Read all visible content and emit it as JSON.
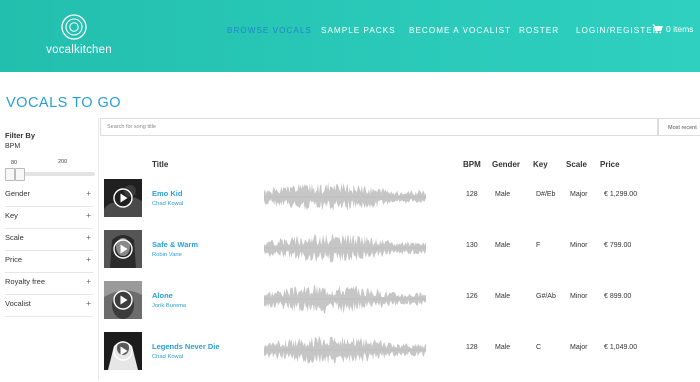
{
  "header": {
    "brand": "vocalkitchen",
    "nav": [
      {
        "label": "BROWSE VOCALS",
        "active": true
      },
      {
        "label": "SAMPLE PACKS",
        "active": false
      },
      {
        "label": "BECOME A VOCALIST",
        "active": false
      },
      {
        "label": "ROSTER",
        "active": false
      },
      {
        "label": "LOGIN/REGISTER",
        "active": false
      }
    ],
    "cart_label": "0 items",
    "cart_icon": "cart-icon"
  },
  "page_title": "VOCALS TO GO",
  "filters": {
    "title": "Filter By",
    "bpm_label": "BPM",
    "bpm_min": "80",
    "bpm_max": "200",
    "facets": [
      {
        "label": "Gender",
        "icon": "plus"
      },
      {
        "label": "Key",
        "icon": "plus"
      },
      {
        "label": "Scale",
        "icon": "plus"
      },
      {
        "label": "Price",
        "icon": "plus"
      },
      {
        "label": "Royalty free",
        "icon": "plus"
      },
      {
        "label": "Vocalist",
        "icon": "plus"
      }
    ]
  },
  "search": {
    "placeholder": "Search for song title",
    "value": "",
    "sort_label": "Most recent"
  },
  "table": {
    "columns": {
      "title": "Title",
      "bpm": "BPM",
      "gender": "Gender",
      "key": "Key",
      "scale": "Scale",
      "price": "Price"
    },
    "rows": [
      {
        "title": "Emo Kid",
        "artist": "Chad Kowal",
        "bpm": "128",
        "gender": "Male",
        "key": "D#/Eb",
        "scale": "Major",
        "price": "€ 1,299.00",
        "play_icon": "play-icon"
      },
      {
        "title": "Safe & Warm",
        "artist": "Robin Vane",
        "bpm": "130",
        "gender": "Male",
        "key": "F",
        "scale": "Minor",
        "price": "€ 799.00",
        "play_icon": "play-icon"
      },
      {
        "title": "Alone",
        "artist": "Jorik Burema",
        "bpm": "126",
        "gender": "Male",
        "key": "G#/Ab",
        "scale": "Minor",
        "price": "€ 899.00",
        "play_icon": "play-icon"
      },
      {
        "title": "Legends Never Die",
        "artist": "Chad Kowal",
        "bpm": "128",
        "gender": "Male",
        "key": "C",
        "scale": "Major",
        "price": "€ 1,049.00",
        "play_icon": "play-icon"
      }
    ]
  },
  "colors": {
    "header": "#2cc9b8",
    "accent": "#2a9ed6",
    "active_nav": "#1f86c9",
    "waveform": "#c6c6c6"
  }
}
